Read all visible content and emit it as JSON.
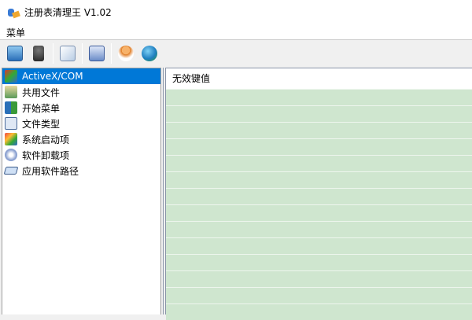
{
  "window": {
    "title": "注册表清理王 V1.02"
  },
  "menu": {
    "items": [
      {
        "label": "菜单"
      }
    ]
  },
  "toolbar": {
    "buttons": [
      {
        "icon": "scan-monitor-icon"
      },
      {
        "icon": "broom-clean-icon"
      },
      {
        "icon": "document-icon"
      },
      {
        "icon": "restore-icon"
      },
      {
        "icon": "user-icon"
      },
      {
        "icon": "help-globe-icon"
      }
    ]
  },
  "sidebar": {
    "items": [
      {
        "label": "ActiveX/COM",
        "selected": true,
        "icon": "activex-icon"
      },
      {
        "label": "共用文件",
        "icon": "shared-file-icon"
      },
      {
        "label": "开始菜单",
        "icon": "start-menu-icon"
      },
      {
        "label": "文件类型",
        "icon": "file-type-icon"
      },
      {
        "label": "系统启动项",
        "icon": "startup-icon"
      },
      {
        "label": "软件卸载项",
        "icon": "uninstall-icon"
      },
      {
        "label": "应用软件路径",
        "icon": "app-path-icon"
      }
    ]
  },
  "list": {
    "column_header": "无效键值",
    "rows": []
  },
  "colors": {
    "selection": "#0078d7",
    "row_bg": "#cfe6cf"
  }
}
